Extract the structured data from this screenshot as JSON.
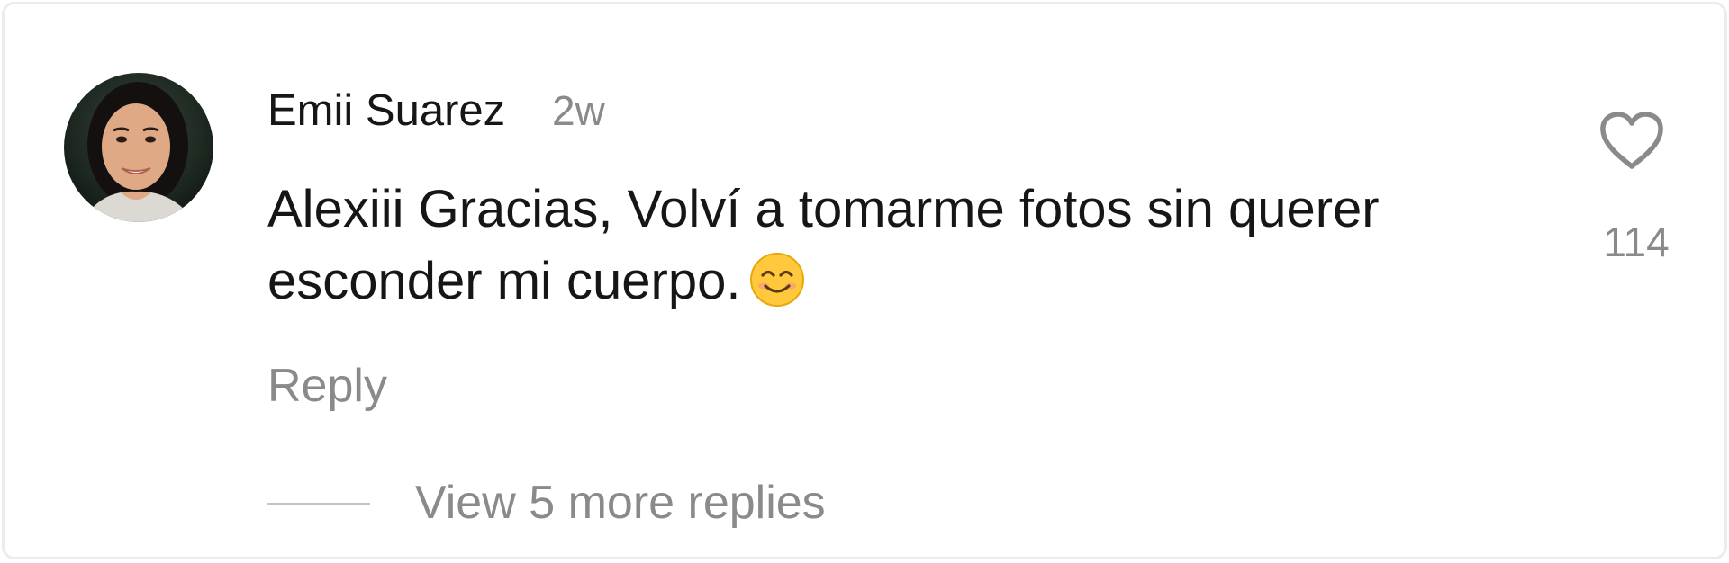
{
  "comment": {
    "username": "Emii Suarez",
    "timestamp": "2w",
    "text": "Alexiii Gracias, Volví a tomarme fotos sin querer esconder mi cuerpo.",
    "emoji": "smiling-face-emoji",
    "reply_label": "Reply",
    "like_count": "114",
    "view_replies_label": "View 5 more replies"
  },
  "icons": {
    "like": "heart-outline-icon",
    "avatar": "user-avatar-photo"
  },
  "colors": {
    "primary_text": "#161616",
    "secondary_text": "#8a8a8a",
    "divider": "#c4c4c4",
    "border": "#ececec",
    "emoji_face": "#ffc83d"
  }
}
